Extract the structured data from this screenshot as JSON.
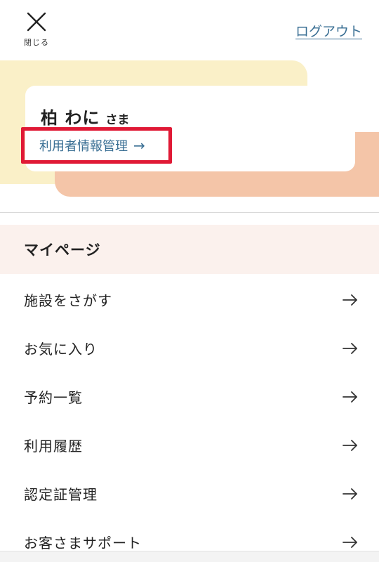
{
  "header": {
    "close_label": "閉じる",
    "logout_label": "ログアウト"
  },
  "user": {
    "name": "柏 わに",
    "honorific": "さま",
    "account_link": "利用者情報管理"
  },
  "section": {
    "title": "マイページ"
  },
  "menu": {
    "items": [
      {
        "label": "施設をさがす"
      },
      {
        "label": "お気に入り"
      },
      {
        "label": "予約一覧"
      },
      {
        "label": "利用履歴"
      },
      {
        "label": "認定証管理"
      },
      {
        "label": "お客さまサポート"
      }
    ]
  },
  "icons": {
    "close": "close-icon",
    "arrow": "arrow-right-icon"
  },
  "colors": {
    "link": "#3a6f94",
    "hero_yellow": "#faf0c8",
    "hero_peach": "#f4c5a8",
    "section_bg": "#fbf1ed",
    "highlight": "#e01935"
  }
}
